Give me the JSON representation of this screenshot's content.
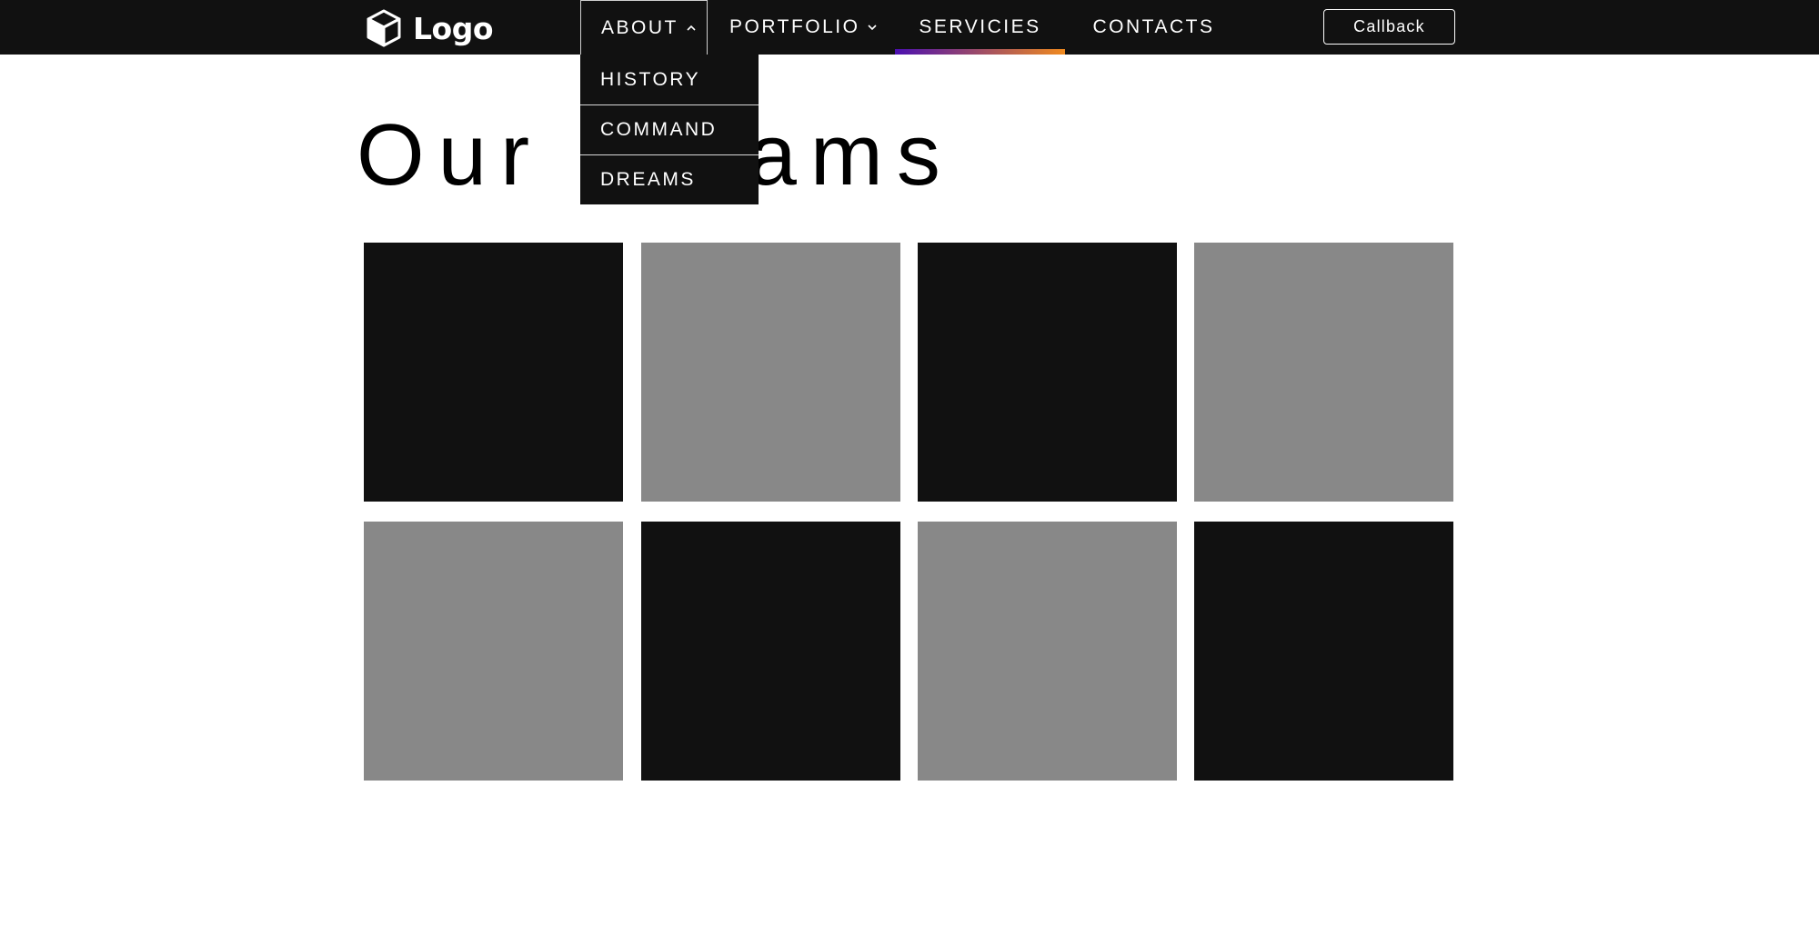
{
  "header": {
    "logo_text": "Logo",
    "nav": {
      "about": "ABOUT",
      "portfolio": "PORTFOLIO",
      "services": "SERVICIES",
      "contacts": "CONTACTS"
    },
    "callback_label": "Callback",
    "accent_gradient": [
      "#4b0fb0",
      "#f08a1e"
    ]
  },
  "dropdown": {
    "items": [
      "HISTORY",
      "COMMAND",
      "DREAMS"
    ]
  },
  "main": {
    "title": "Our dreams"
  },
  "gallery": {
    "colors": {
      "dark": "#111111",
      "gray": "#888888"
    },
    "tiles": [
      "dark",
      "gray",
      "dark",
      "gray",
      "gray",
      "dark",
      "gray",
      "dark"
    ]
  }
}
